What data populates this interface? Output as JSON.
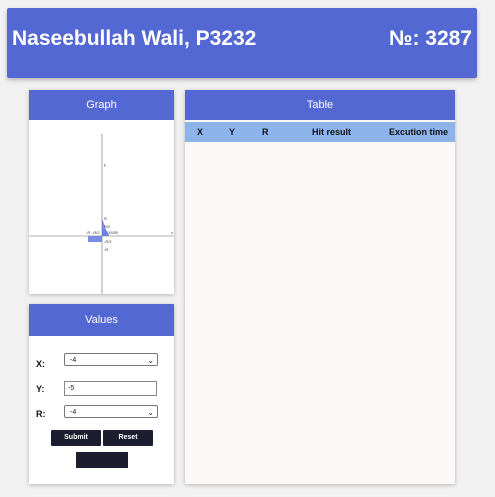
{
  "header": {
    "name": "Naseebullah Wali, P3232",
    "number": "№: 3287"
  },
  "graph_panel": {
    "title": "Graph",
    "axis_y": "y",
    "axis_x": "x",
    "labels": {
      "r_top": "R",
      "half_r_top": "R/2",
      "neg_r": "-R",
      "neg_half_r": "-R/2",
      "r_right": "R",
      "half_r_right": "R/2",
      "neg_r_left": "-R",
      "neg_half_r_left": "-R/2"
    },
    "area_color": "#6c7fe0"
  },
  "table_panel": {
    "title": "Table",
    "columns": [
      "X",
      "Y",
      "R",
      "Hit result",
      "Excution time"
    ],
    "rows": []
  },
  "values_panel": {
    "title": "Values",
    "x_label": "X:",
    "x_value": "-4",
    "y_label": "Y:",
    "y_value": "-5",
    "r_label": "R:",
    "r_value": "-4",
    "submit_label": "Submit",
    "reset_label": "Reset"
  },
  "colors": {
    "accent": "#5468d4",
    "table_header": "#8cb3ea",
    "button": "#1c1e30"
  }
}
